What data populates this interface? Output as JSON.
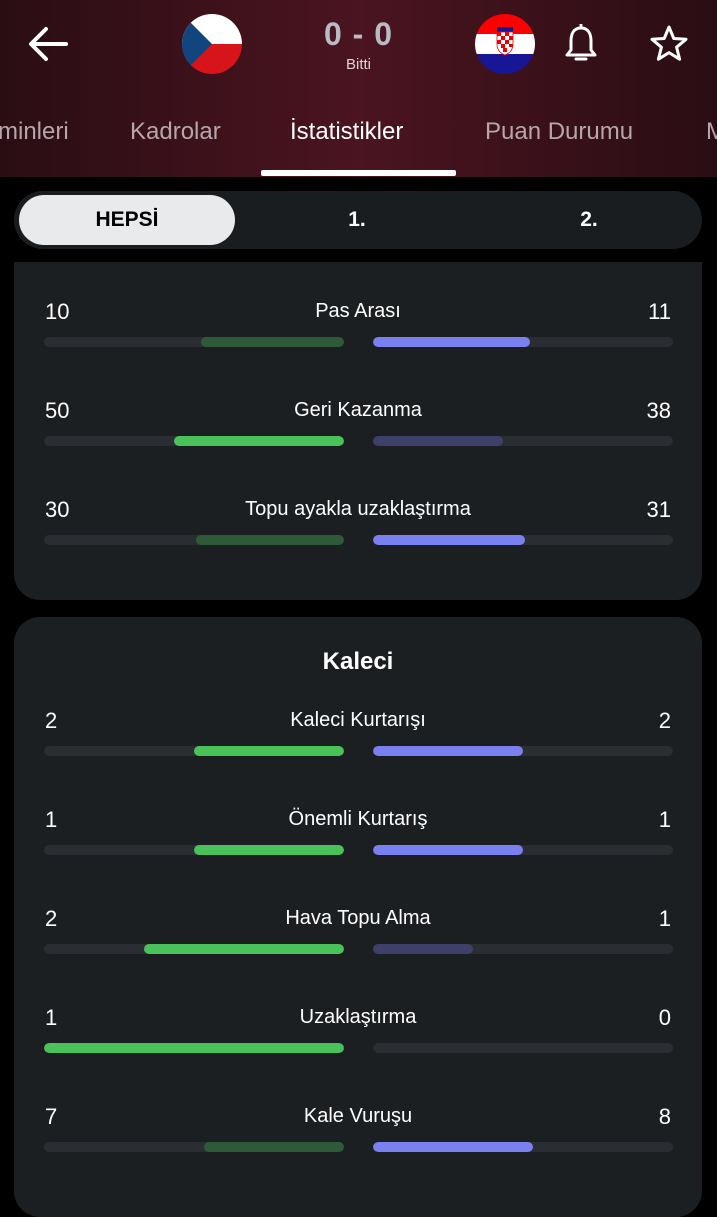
{
  "match": {
    "home_score": "0",
    "separator": "-",
    "away_score": "0",
    "status": "Bitti"
  },
  "icons": {
    "back": "arrow-left-icon",
    "home_flag": "czech-flag-icon",
    "away_flag": "croatia-flag-icon",
    "notifications": "bell-icon",
    "favorite": "star-icon"
  },
  "tabs": [
    {
      "label": "minleri",
      "active": false
    },
    {
      "label": "Kadrolar",
      "active": false
    },
    {
      "label": "İstatistikler",
      "active": true
    },
    {
      "label": "Puan Durumu",
      "active": false
    },
    {
      "label": "M",
      "active": false
    }
  ],
  "periods": [
    {
      "label": "HEPSİ",
      "active": true
    },
    {
      "label": "1.",
      "active": false
    },
    {
      "label": "2.",
      "active": false
    }
  ],
  "colors": {
    "home_strong": "#4ac25a",
    "home_weak": "#2f5a3a",
    "away_strong": "#7b80f0",
    "away_weak": "#3d4068",
    "track": "#2a2d31",
    "card": "#1c1f22"
  },
  "sections": [
    {
      "title": "",
      "rows": [
        {
          "label": "Pas Arası",
          "home": "10",
          "away": "11",
          "home_frac": 0.476,
          "away_frac": 0.524
        },
        {
          "label": "Geri Kazanma",
          "home": "50",
          "away": "38",
          "home_frac": 0.568,
          "away_frac": 0.432
        },
        {
          "label": "Topu ayakla uzaklaştırma",
          "home": "30",
          "away": "31",
          "home_frac": 0.492,
          "away_frac": 0.508
        }
      ]
    },
    {
      "title": "Kaleci",
      "rows": [
        {
          "label": "Kaleci Kurtarışı",
          "home": "2",
          "away": "2",
          "home_frac": 0.5,
          "away_frac": 0.5
        },
        {
          "label": "Önemli Kurtarış",
          "home": "1",
          "away": "1",
          "home_frac": 0.5,
          "away_frac": 0.5
        },
        {
          "label": "Hava Topu Alma",
          "home": "2",
          "away": "1",
          "home_frac": 0.667,
          "away_frac": 0.333
        },
        {
          "label": "Uzaklaştırma",
          "home": "1",
          "away": "0",
          "home_frac": 1.0,
          "away_frac": 0.0
        },
        {
          "label": "Kale Vuruşu",
          "home": "7",
          "away": "8",
          "home_frac": 0.467,
          "away_frac": 0.533
        }
      ]
    }
  ]
}
